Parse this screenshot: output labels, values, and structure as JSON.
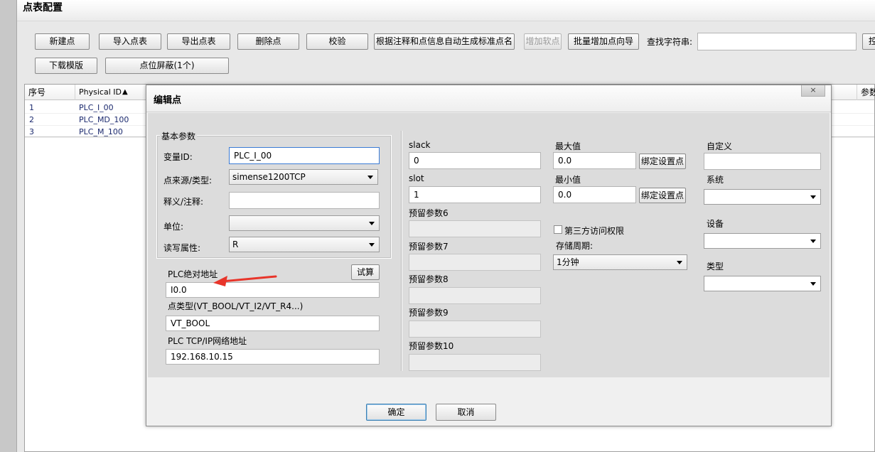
{
  "window": {
    "title": "点表配置"
  },
  "toolbar": {
    "new_point": "新建点",
    "import": "导入点表",
    "export": "导出点表",
    "delete": "删除点",
    "verify": "校验",
    "auto_name": "根据注释和点信息自动生成标准点名",
    "add_soft": "增加软点",
    "batch_add": "批量增加点向导",
    "search_label": "查找字符串:",
    "search_value": "",
    "search_button_partial": "控",
    "download_template": "下载模版",
    "mask": "点位屏蔽(1个)"
  },
  "grid": {
    "columns": [
      "序号",
      "Physical ID",
      "参数"
    ],
    "sort_indicator": "▲",
    "rows": [
      {
        "index": "1",
        "id": "PLC_I_00"
      },
      {
        "index": "2",
        "id": "PLC_MD_100"
      },
      {
        "index": "3",
        "id": "PLC_M_100"
      }
    ]
  },
  "dialog": {
    "title": "编辑点",
    "close": "×",
    "basic": {
      "group_title": "基本参数",
      "var_id_label": "变量ID:",
      "var_id_value": "PLC_I_00",
      "source_label": "点来源/类型:",
      "source_value": "simense1200TCP",
      "comment_label": "释义/注释:",
      "comment_value": "",
      "unit_label": "单位:",
      "unit_value": "",
      "rw_label": "读写属性:",
      "rw_value": "R"
    },
    "plc": {
      "addr_label": "PLC绝对地址",
      "test_button": "试算",
      "addr_value": "I0.0",
      "type_label": "点类型(VT_BOOL/VT_I2/VT_R4...)",
      "type_value": "VT_BOOL",
      "ip_label": "PLC TCP/IP网络地址",
      "ip_value": "192.168.10.15"
    },
    "params": {
      "slack_label": "slack",
      "slack_value": "0",
      "slot_label": "slot",
      "slot_value": "1",
      "reserve6": "预留参数6",
      "reserve7": "预留参数7",
      "reserve8": "预留参数8",
      "reserve9": "预留参数9",
      "reserve10": "预留参数10"
    },
    "range": {
      "max_label": "最大值",
      "max_value": "0.0",
      "min_label": "最小值",
      "min_value": "0.0",
      "bind_button": "绑定设置点",
      "third_party": "第三方访问权限",
      "storage_label": "存储周期:",
      "storage_value": "1分钟"
    },
    "custom": {
      "custom_label": "自定义",
      "system_label": "系统",
      "device_label": "设备",
      "type_label": "类型"
    },
    "ok": "确定",
    "cancel": "取消"
  },
  "colors": {
    "annotation_arrow": "#e8352a",
    "grid_text": "#1c2a6e"
  }
}
